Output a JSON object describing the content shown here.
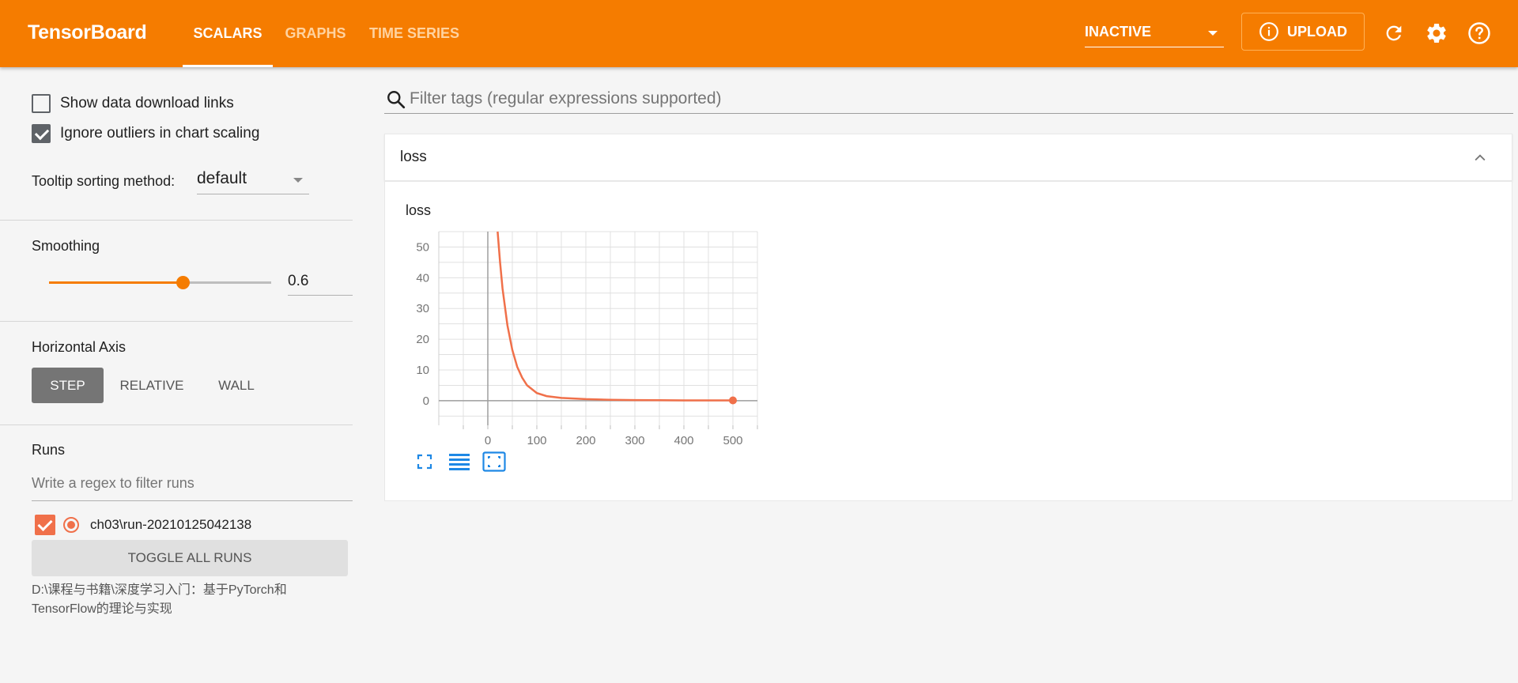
{
  "header": {
    "brand": "TensorBoard",
    "tabs": [
      {
        "label": "SCALARS",
        "active": true
      },
      {
        "label": "GRAPHS",
        "active": false
      },
      {
        "label": "TIME SERIES",
        "active": false
      }
    ],
    "status_select": "INACTIVE",
    "upload_label": "UPLOAD",
    "icons": [
      "info-icon",
      "refresh-icon",
      "settings-icon",
      "help-icon"
    ]
  },
  "sidebar": {
    "show_download_links": {
      "label": "Show data download links",
      "checked": false
    },
    "ignore_outliers": {
      "label": "Ignore outliers in chart scaling",
      "checked": true
    },
    "tooltip_sorting": {
      "label": "Tooltip sorting method:",
      "value": "default"
    },
    "smoothing": {
      "label": "Smoothing",
      "value": "0.6",
      "fraction": 0.6
    },
    "horizontal_axis": {
      "label": "Horizontal Axis",
      "options": [
        "STEP",
        "RELATIVE",
        "WALL"
      ],
      "selected": "STEP"
    },
    "runs": {
      "label": "Runs",
      "filter_placeholder": "Write a regex to filter runs",
      "items": [
        {
          "name": "ch03\\run-20210125042138",
          "checked": true,
          "color": "#f0704a"
        }
      ],
      "toggle_all_label": "TOGGLE ALL RUNS",
      "logdir": "D:\\课程与书籍\\深度学习入门：基于PyTorch和TensorFlow的理论与实现"
    }
  },
  "main": {
    "filter_placeholder": "Filter tags (regular expressions supported)",
    "card_title": "loss",
    "chart_title": "loss"
  },
  "chart_data": {
    "type": "line",
    "title": "loss",
    "xlabel": "",
    "ylabel": "",
    "xlim": [
      -100,
      550
    ],
    "ylim": [
      -8,
      55
    ],
    "x_ticks": [
      0,
      100,
      200,
      300,
      400,
      500
    ],
    "y_ticks": [
      0,
      10,
      20,
      30,
      40,
      50
    ],
    "grid": true,
    "series": [
      {
        "color": "#f0704a",
        "x": [
          20,
          25,
          30,
          40,
          50,
          60,
          70,
          80,
          100,
          120,
          150,
          200,
          250,
          300,
          350,
          400,
          450,
          500
        ],
        "y": [
          55,
          45,
          36.5,
          24.5,
          16.5,
          11,
          7.5,
          5,
          2.5,
          1.5,
          0.9,
          0.5,
          0.3,
          0.2,
          0.15,
          0.1,
          0.1,
          0.1
        ]
      }
    ]
  },
  "colors": {
    "accent": "#f57c00",
    "run": "#f0704a",
    "tool_blue": "#1e88e5"
  }
}
